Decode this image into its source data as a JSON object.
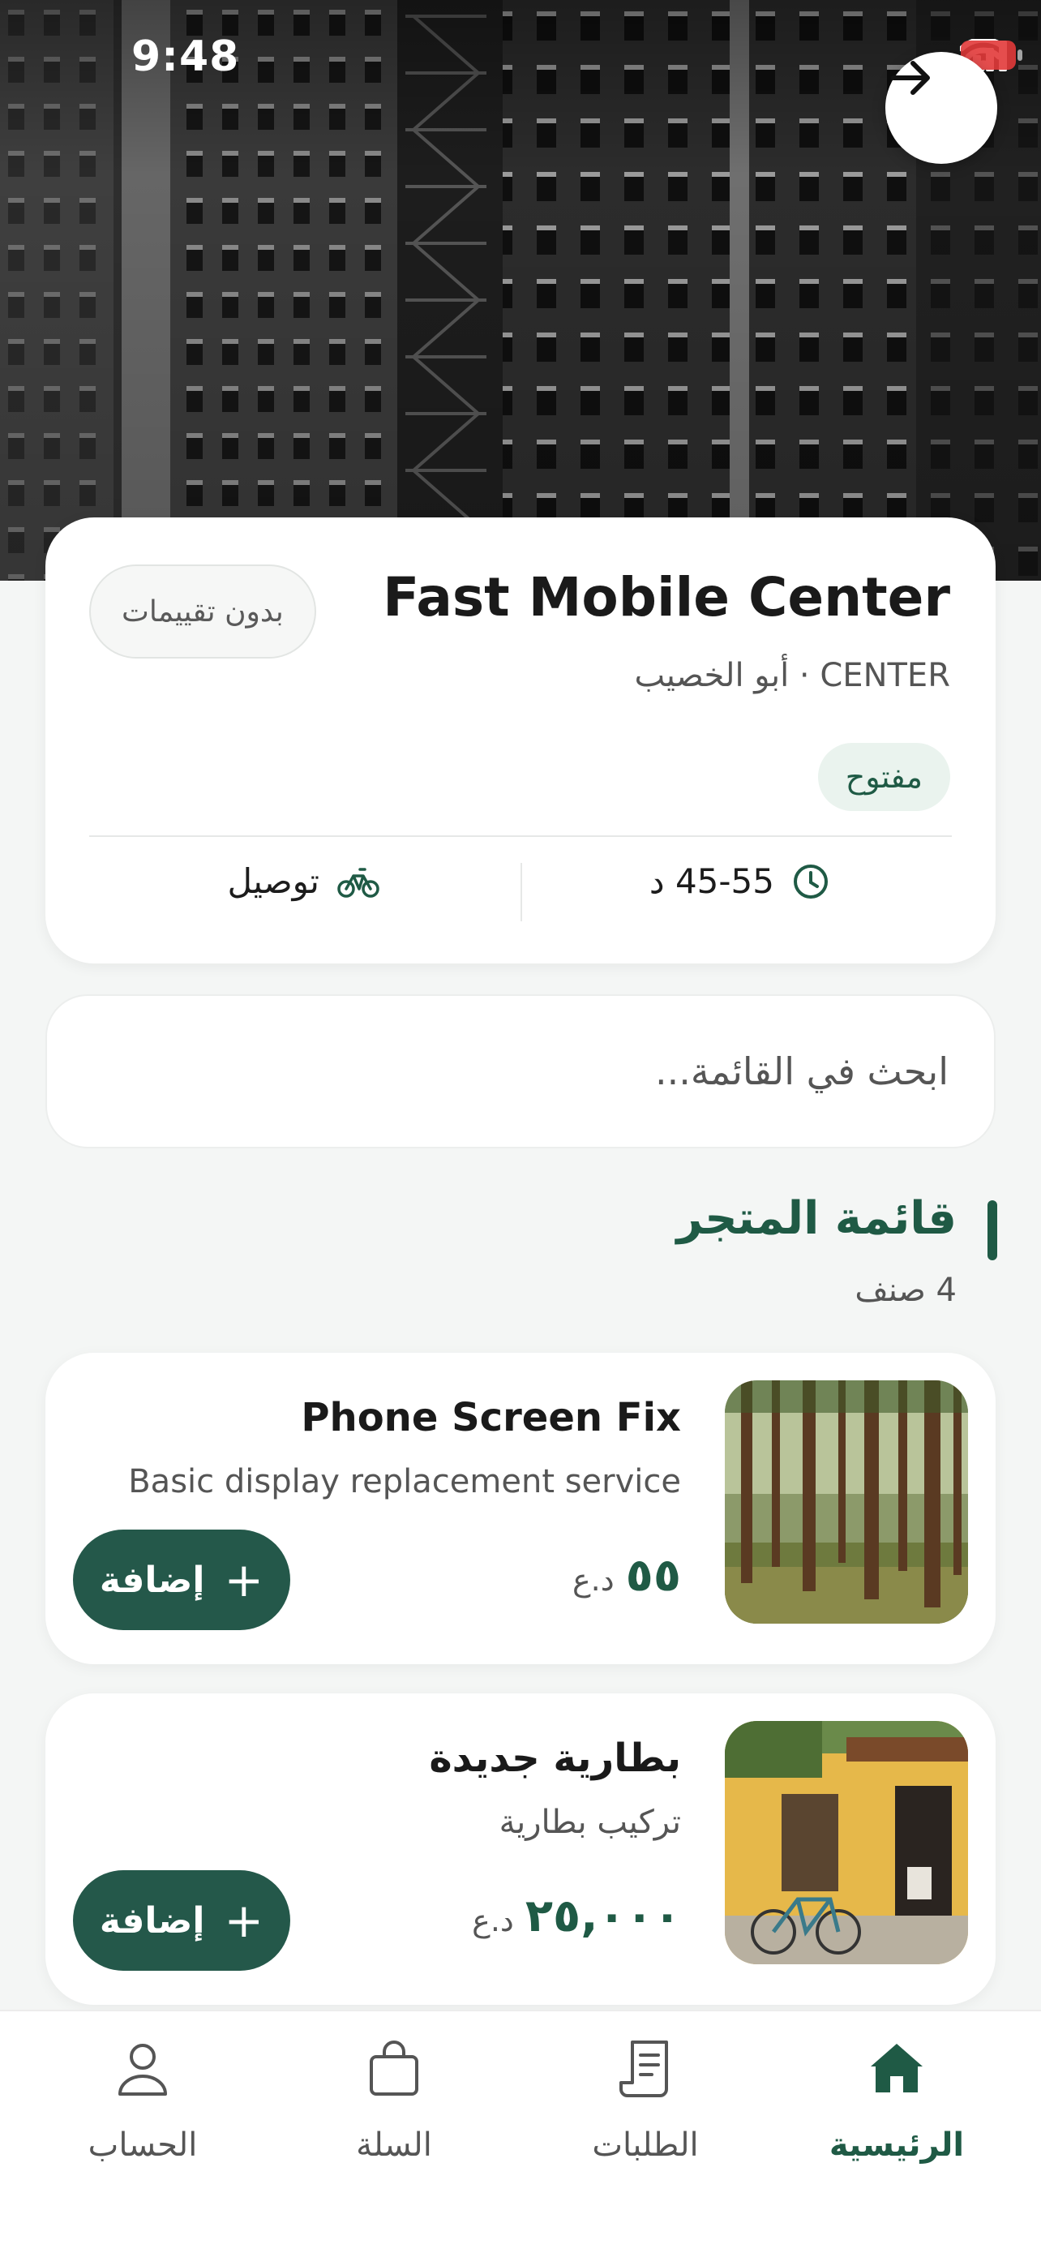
{
  "status_bar": {
    "time": "9:48",
    "battery": "15"
  },
  "store": {
    "name": "Fast Mobile Center",
    "rating_label": "بدون تقييمات",
    "subtitle": "CENTER · أبو الخصيب",
    "status": "مفتوح",
    "delivery_time": "45-55 د",
    "delivery_label": "توصيل"
  },
  "search": {
    "placeholder": "ابحث في القائمة..."
  },
  "menu": {
    "title": "قائمة المتجر",
    "count": "4 صنف",
    "items": [
      {
        "name": "Phone Screen Fix",
        "description": "Basic display replacement service",
        "price": "٥٥",
        "currency": "د.ع",
        "add_label": "إضافة",
        "image": "forest-photo"
      },
      {
        "name": "بطارية جديدة",
        "description": "تركيب بطارية",
        "price": "٢٥,٠٠٠",
        "currency": "د.ع",
        "add_label": "إضافة",
        "image": "yellow-house-bicycle-photo"
      }
    ]
  },
  "nav": {
    "items": [
      {
        "label": "الرئيسية",
        "icon": "home-icon",
        "active": true
      },
      {
        "label": "الطلبات",
        "icon": "receipt-icon",
        "active": false
      },
      {
        "label": "السلة",
        "icon": "bag-icon",
        "active": false
      },
      {
        "label": "الحساب",
        "icon": "user-icon",
        "active": false
      }
    ]
  },
  "colors": {
    "accent": "#1f5a45",
    "button": "#24584a",
    "badge_bg": "#eaf3ee",
    "background": "#f4f6f5"
  }
}
